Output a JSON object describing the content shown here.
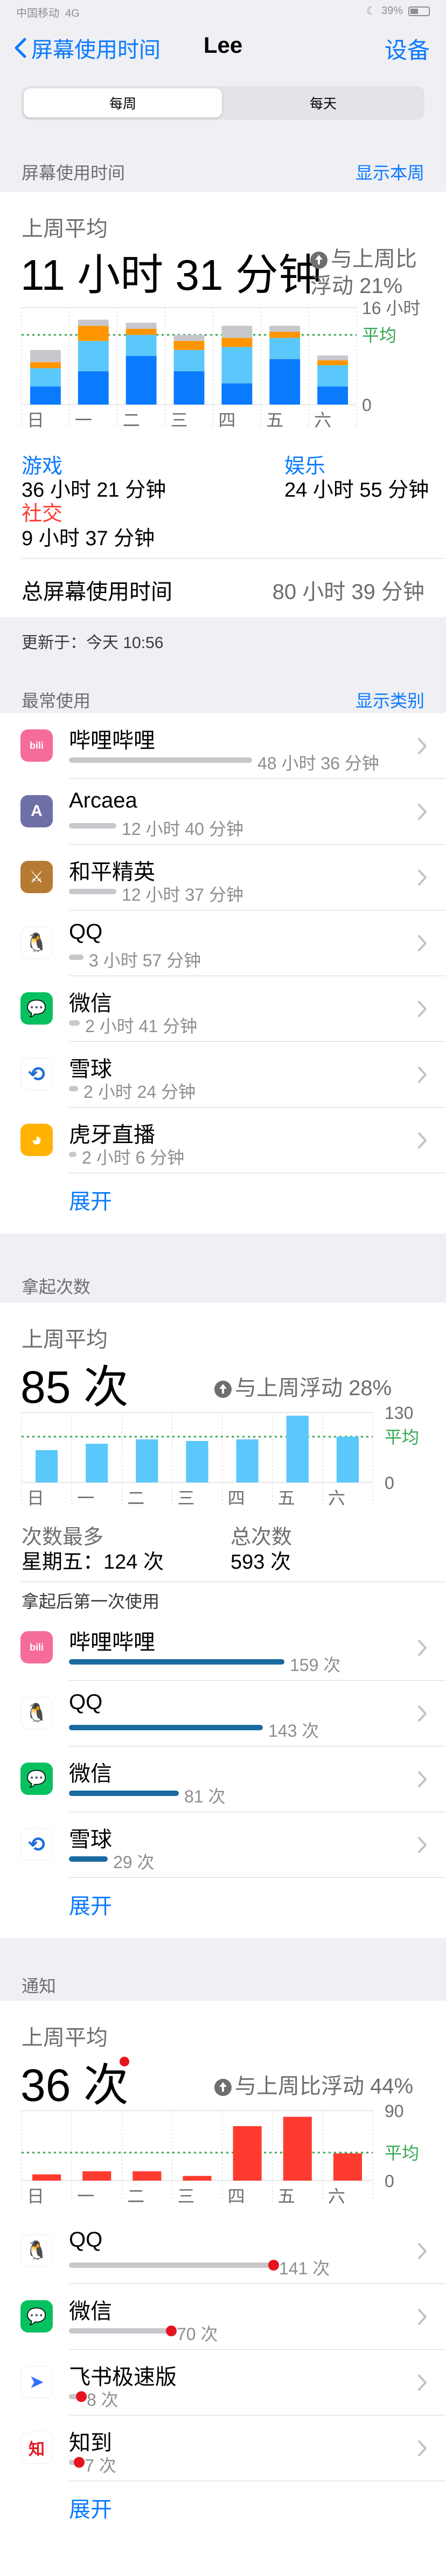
{
  "status": {
    "carrier": "中国移动",
    "network": "4G",
    "battery": "39%"
  },
  "nav": {
    "back": "屏幕使用时间",
    "title": "Lee",
    "settings": "设备"
  },
  "segment": {
    "weekly": "每周",
    "daily": "每天"
  },
  "screen_time": {
    "header": "屏幕使用时间",
    "link": "显示本周",
    "avg_label": "上周平均",
    "avg_value": "11 小时 31 分钟",
    "compare_1": "与上周比",
    "compare_2": "浮动 21%",
    "max_label": "16 小时",
    "avg_line": "平均",
    "zero": "0",
    "days": [
      "日",
      "一",
      "二",
      "三",
      "四",
      "五",
      "六"
    ],
    "categories": [
      {
        "name": "游戏",
        "time": "36 小时 21 分钟",
        "color": "#0a7aff"
      },
      {
        "name": "娱乐",
        "time": "24 小时 55 分钟",
        "color": "#5ac8fa"
      },
      {
        "name": "社交",
        "time": "9 小时 37 分钟",
        "color": "#ff9500"
      }
    ],
    "total_label": "总屏幕使用时间",
    "total_value": "80 小时 39 分钟",
    "updated": "更新于：今天 10:56"
  },
  "chart_data": [
    {
      "type": "bar",
      "categories": [
        "日",
        "一",
        "二",
        "三",
        "四",
        "五",
        "六"
      ],
      "series": [
        {
          "name": "游戏",
          "values": [
            3.0,
            5.5,
            8.0,
            5.5,
            3.5,
            7.5,
            3.0
          ]
        },
        {
          "name": "娱乐",
          "values": [
            3.0,
            5.0,
            3.5,
            3.5,
            6.0,
            3.5,
            3.5
          ]
        },
        {
          "name": "社交",
          "values": [
            1.0,
            2.5,
            1.0,
            1.5,
            1.5,
            1.0,
            0.8
          ]
        },
        {
          "name": "",
          "values": [
            2.0,
            1.0,
            1.0,
            1.0,
            2.0,
            1.0,
            0.8
          ]
        }
      ],
      "ylim": [
        0,
        16
      ],
      "average": 11.5
    },
    {
      "type": "bar",
      "categories": [
        "日",
        "一",
        "二",
        "三",
        "四",
        "五",
        "六"
      ],
      "values": [
        60,
        72,
        80,
        77,
        80,
        124,
        85
      ],
      "ylim": [
        0,
        130
      ],
      "average": 85
    },
    {
      "type": "bar",
      "categories": [
        "日",
        "一",
        "二",
        "三",
        "四",
        "五",
        "六"
      ],
      "values": [
        8,
        12,
        12,
        6,
        70,
        82,
        35
      ],
      "ylim": [
        0,
        90
      ],
      "average": 36
    }
  ],
  "most_used": {
    "header": "最常使用",
    "link": "显示类别",
    "apps": [
      {
        "name": "哔哩哔哩",
        "value": "48 小时 36 分钟",
        "fraction": 1.0,
        "icon": "bilibili-icon",
        "color": "#f56c9a"
      },
      {
        "name": "Arcaea",
        "value": "12 小时 40 分钟",
        "fraction": 0.26,
        "icon": "arcaea-icon",
        "color": "#7d7fb8"
      },
      {
        "name": "和平精英",
        "value": "12 小时 37 分钟",
        "fraction": 0.26,
        "icon": "game-icon",
        "color": "#c88a3a"
      },
      {
        "name": "QQ",
        "value": "3 小时 57 分钟",
        "fraction": 0.08,
        "icon": "qq-icon",
        "color": "#000000"
      },
      {
        "name": "微信",
        "value": "2 小时 41 分钟",
        "fraction": 0.06,
        "icon": "wechat-icon",
        "color": "#07c160"
      },
      {
        "name": "雪球",
        "value": "2 小时 24 分钟",
        "fraction": 0.05,
        "icon": "xueqiu-icon",
        "color": "#1f6fd6"
      },
      {
        "name": "虎牙直播",
        "value": "2 小时 6 分钟",
        "fraction": 0.04,
        "icon": "huya-icon",
        "color": "#ffb300"
      }
    ],
    "expand": "展开"
  },
  "pickups": {
    "header": "拿起次数",
    "avg_label": "上周平均",
    "avg_value": "85 次",
    "compare": "与上周浮动 28%",
    "max_label": "130",
    "avg_line": "平均",
    "zero": "0",
    "most_label": "次数最多",
    "most_value": "星期五：124 次",
    "total_label": "总次数",
    "total_value": "593 次",
    "first_header": "拿起后第一次使用",
    "apps": [
      {
        "name": "哔哩哔哩",
        "value": "159 次",
        "fraction": 1.0,
        "icon": "bilibili-icon"
      },
      {
        "name": "QQ",
        "value": "143 次",
        "fraction": 0.9,
        "icon": "qq-icon"
      },
      {
        "name": "微信",
        "value": "81 次",
        "fraction": 0.51,
        "icon": "wechat-icon"
      },
      {
        "name": "雪球",
        "value": "29 次",
        "fraction": 0.18,
        "icon": "xueqiu-icon"
      }
    ],
    "expand": "展开"
  },
  "notifications": {
    "header": "通知",
    "avg_label": "上周平均",
    "avg_value": "36 次",
    "compare": "与上周比浮动 44%",
    "max_label": "90",
    "avg_line": "平均",
    "zero": "0",
    "apps": [
      {
        "name": "QQ",
        "value": "141 次",
        "fraction": 1.0,
        "icon": "qq-icon"
      },
      {
        "name": "微信",
        "value": "70 次",
        "fraction": 0.5,
        "icon": "wechat-icon"
      },
      {
        "name": "飞书极速版",
        "value": "8 次",
        "fraction": 0.06,
        "icon": "feishu-icon"
      },
      {
        "name": "知到",
        "value": "7 次",
        "fraction": 0.05,
        "icon": "zhidao-icon"
      }
    ],
    "expand": "展开"
  }
}
